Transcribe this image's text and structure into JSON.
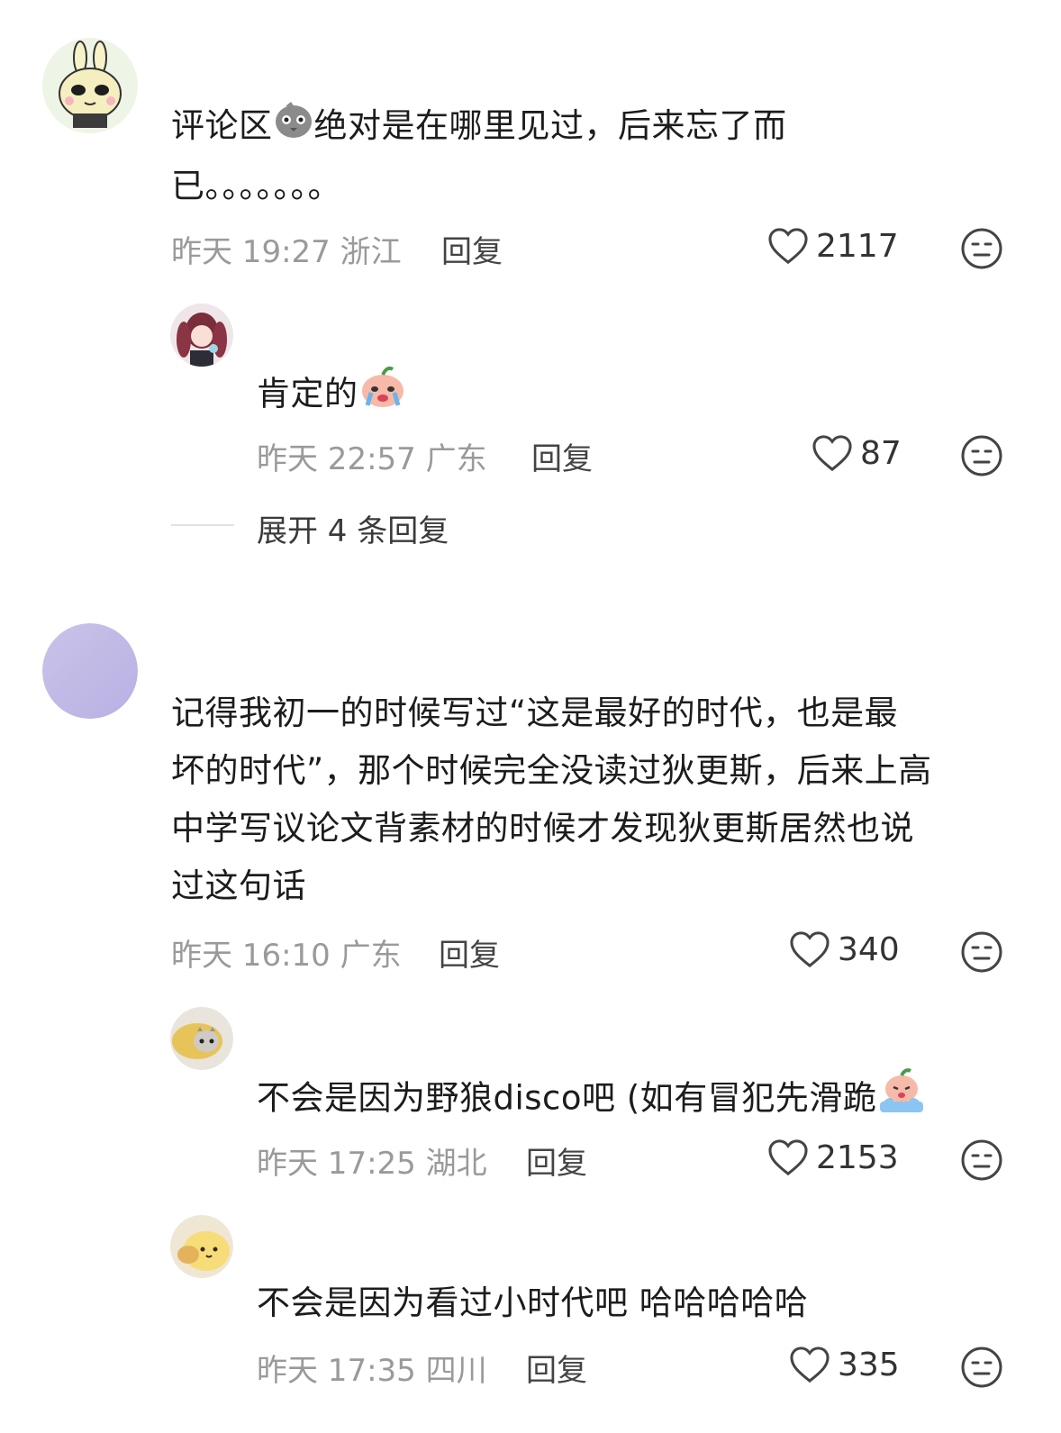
{
  "comments": [
    {
      "text_pre": "评论区",
      "text_post": "绝对是在哪里见过，后来忘了而",
      "text_line2": "已。。。。。。。",
      "time": "昨天 19:27",
      "location": "浙江",
      "reply_label": "回复",
      "likes": "2117",
      "avatar_icon": "rabbit-avatar-icon",
      "replies": [
        {
          "text": "肯定的",
          "time": "昨天 22:57",
          "location": "广东",
          "reply_label": "回复",
          "likes": "87",
          "avatar_icon": "anime-girl-avatar-icon",
          "emoji": "crying-peach-emoji"
        }
      ],
      "expand_label": "展开 4 条回复"
    },
    {
      "lines": [
        "记得我初一的时候写过“这是最好的时代，也是最",
        "坏的时代”，那个时候完全没读过狄更斯，后来上高",
        "中学写议论文背素材的时候才发现狄更斯居然也说",
        "过这句话"
      ],
      "time": "昨天 16:10",
      "location": "广东",
      "reply_label": "回复",
      "likes": "340",
      "avatar_icon": "purple-avatar-icon",
      "replies": [
        {
          "text": "不会是因为野狼disco吧 (如有冒犯先滑跪",
          "time": "昨天 17:25",
          "location": "湖北",
          "reply_label": "回复",
          "likes": "2153",
          "avatar_icon": "cat-avatar-icon",
          "emoji": "kneeling-peach-emoji"
        },
        {
          "text": "不会是因为看过小时代吧 哈哈哈哈哈",
          "time": "昨天 17:35",
          "location": "四川",
          "reply_label": "回复",
          "likes": "335",
          "avatar_icon": "pompompurin-avatar-icon"
        }
      ]
    }
  ],
  "colors": {
    "meta_gray": "#9a9a9a",
    "text": "#1c1c1c",
    "icon": "#444444"
  }
}
